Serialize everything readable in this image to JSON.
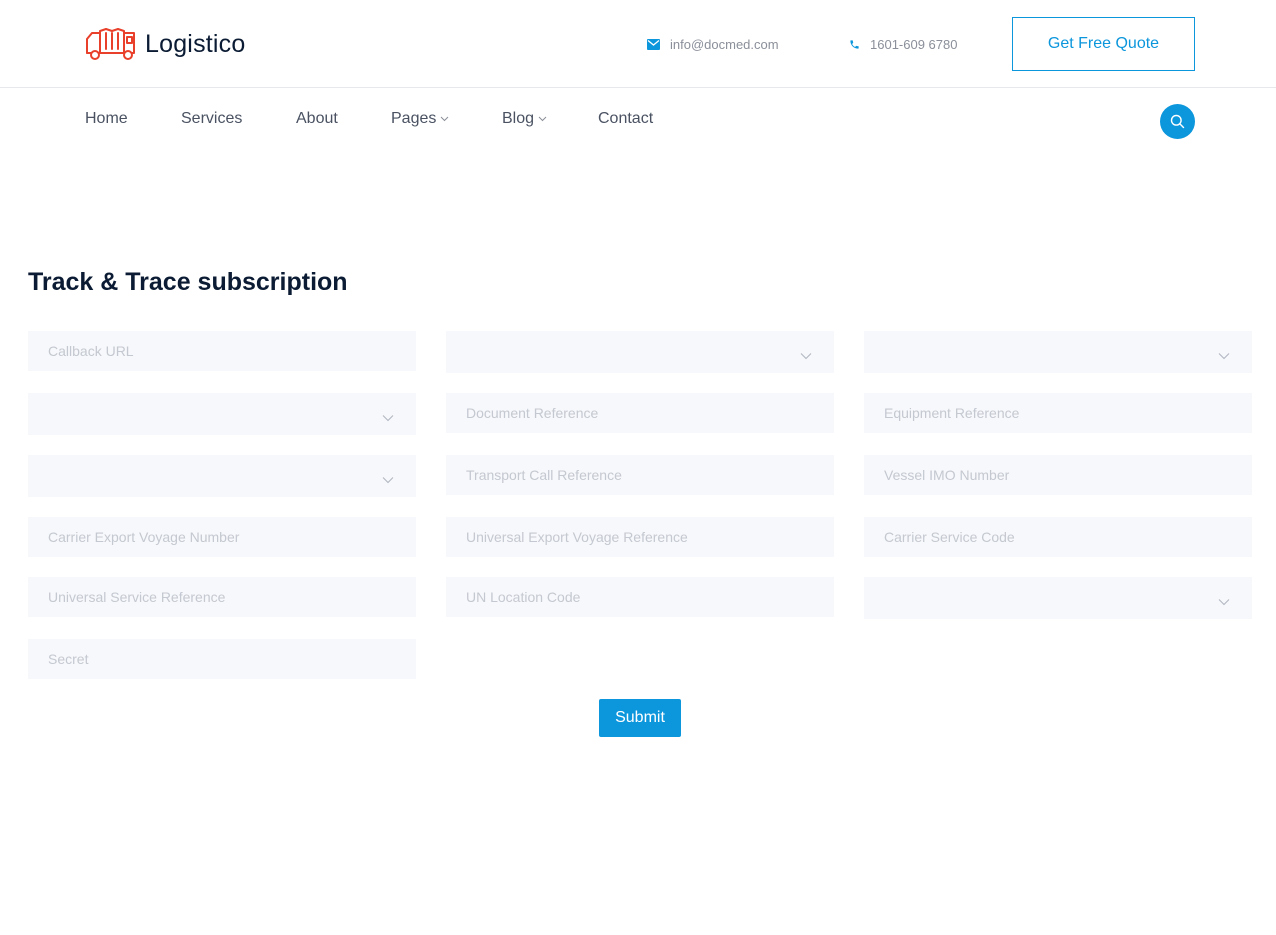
{
  "header": {
    "logo_text": "Logistico",
    "email": "info@docmed.com",
    "phone": "1601-609 6780",
    "quote_button": "Get Free Quote"
  },
  "nav": {
    "items": [
      {
        "label": "Home",
        "has_dropdown": false
      },
      {
        "label": "Services",
        "has_dropdown": false
      },
      {
        "label": "About",
        "has_dropdown": false
      },
      {
        "label": "Pages",
        "has_dropdown": true
      },
      {
        "label": "Blog",
        "has_dropdown": true
      },
      {
        "label": "Contact",
        "has_dropdown": false
      }
    ],
    "search_icon": "search-icon"
  },
  "form": {
    "title": "Track & Trace subscription",
    "fields": {
      "callback_url": {
        "placeholder": "Callback URL",
        "value": ""
      },
      "select_1": {
        "value": ""
      },
      "select_2": {
        "value": ""
      },
      "select_3": {
        "value": ""
      },
      "document_reference": {
        "placeholder": "Document Reference",
        "value": ""
      },
      "equipment_reference": {
        "placeholder": "Equipment Reference",
        "value": ""
      },
      "select_4": {
        "value": ""
      },
      "transport_call_reference": {
        "placeholder": "Transport Call Reference",
        "value": ""
      },
      "vessel_imo_number": {
        "placeholder": "Vessel IMO Number",
        "value": ""
      },
      "carrier_export_voyage_number": {
        "placeholder": "Carrier Export Voyage Number",
        "value": ""
      },
      "universal_export_voyage_reference": {
        "placeholder": "Universal Export Voyage Reference",
        "value": ""
      },
      "carrier_service_code": {
        "placeholder": "Carrier Service Code",
        "value": ""
      },
      "universal_service_reference": {
        "placeholder": "Universal Service Reference",
        "value": ""
      },
      "un_location_code": {
        "placeholder": "UN Location Code",
        "value": ""
      },
      "select_5": {
        "value": ""
      },
      "secret": {
        "placeholder": "Secret",
        "value": ""
      }
    },
    "submit_label": "Submit"
  },
  "colors": {
    "accent": "#0c96dc",
    "logo_red": "#e8402a",
    "text_dark": "#0b1b33",
    "field_bg": "#f7f8fb",
    "placeholder": "#c4c8d0"
  }
}
